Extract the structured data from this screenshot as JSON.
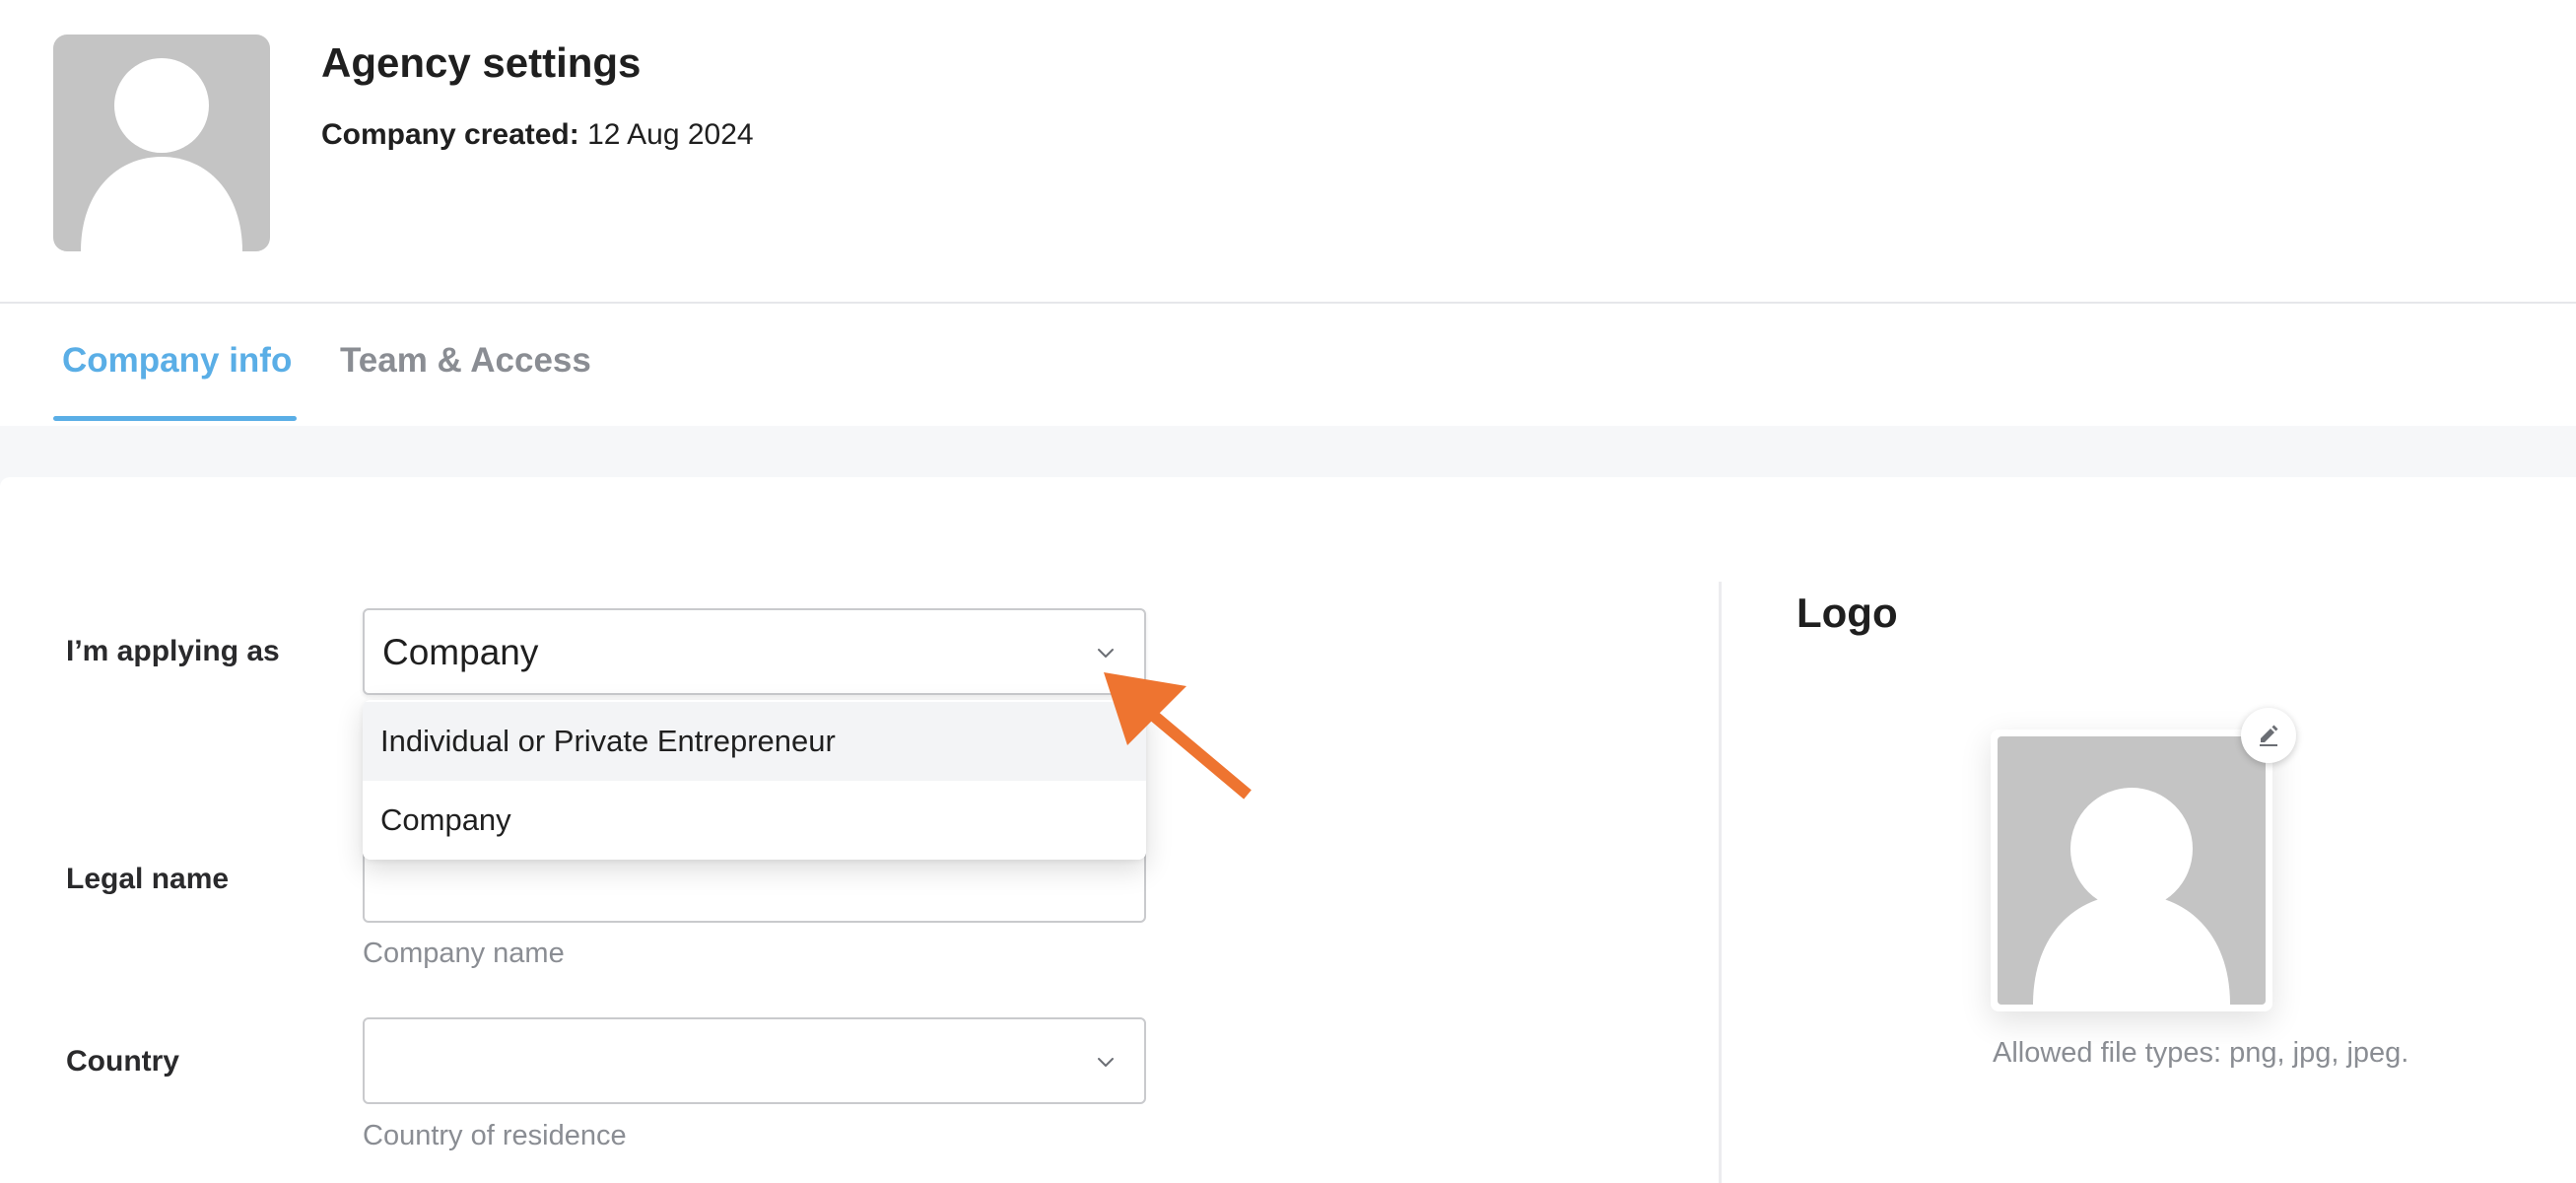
{
  "header": {
    "title": "Agency settings",
    "created_label": "Company created:",
    "created_value": "12 Aug 2024",
    "avatar_icon": "user-placeholder-icon"
  },
  "tabs": [
    {
      "label": "Company info",
      "active": true
    },
    {
      "label": "Team & Access",
      "active": false
    }
  ],
  "form": {
    "applying_as": {
      "label": "I’m applying as",
      "value": "Company",
      "options": [
        "Individual or Private Entrepreneur",
        "Company"
      ]
    },
    "legal_name": {
      "label": "Legal name",
      "value": "",
      "helper": "Company name"
    },
    "country": {
      "label": "Country",
      "value": "",
      "helper": "Country of residence"
    }
  },
  "logo": {
    "title": "Logo",
    "hint": "Allowed file types: png, jpg, jpeg.",
    "edit_icon": "pencil-icon"
  },
  "colors": {
    "accent": "#5aaee6",
    "annotation_arrow": "#ee7430",
    "placeholder_gray": "#c4c4c4"
  }
}
